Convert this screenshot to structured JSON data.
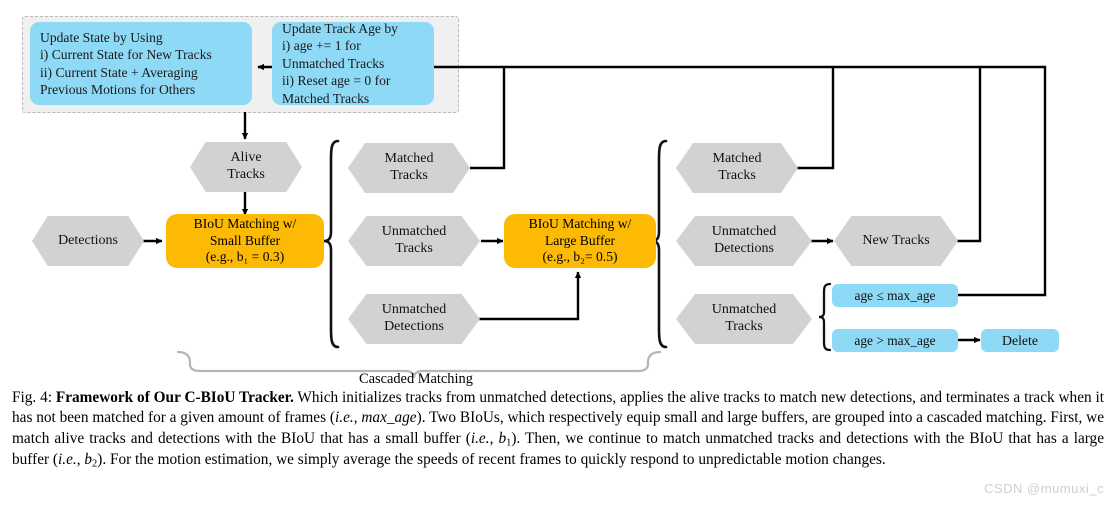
{
  "figure": {
    "update_state_box": {
      "lines": [
        "Update State by Using",
        "i) Current State for New Tracks",
        "ii) Current State + Averaging",
        "Previous Motions for Others"
      ]
    },
    "update_age_box": {
      "lines": [
        "Update Track Age  by",
        "i) age += 1 for",
        "Unmatched Tracks",
        "ii) Reset  age = 0 for",
        "Matched Tracks"
      ]
    },
    "nodes": {
      "alive_tracks": [
        "Alive",
        "Tracks"
      ],
      "detections": [
        "Detections"
      ],
      "biou_small": [
        "BIoU Matching w/",
        "Small Buffer",
        "(e.g., b₁ = 0.3)"
      ],
      "biou_large": [
        "BIoU Matching w/",
        "Large Buffer",
        "(e.g., b₂= 0.5)"
      ],
      "matched_tracks_mid": [
        "Matched",
        "Tracks"
      ],
      "unmatched_tracks_mid": [
        "Unmatched",
        "Tracks"
      ],
      "unmatched_detections_mid": [
        "Unmatched",
        "Detections"
      ],
      "matched_tracks_right": [
        "Matched",
        "Tracks"
      ],
      "unmatched_detections_right": [
        "Unmatched",
        "Detections"
      ],
      "unmatched_tracks_right": [
        "Unmatched",
        "Tracks"
      ],
      "new_tracks": [
        "New Tracks"
      ],
      "age_le": "age ≤ max_age",
      "age_gt": "age > max_age",
      "delete": "Delete"
    },
    "brace_label": "Cascaded Matching"
  },
  "caption": {
    "figure_number": "Fig. 4:",
    "title": "Framework of Our C-BIoU Tracker.",
    "body_1": " Which initializes tracks from unmatched detections, applies the alive tracks to match new detections, and terminates a track when it has not been matched for a given amount of frames (",
    "ie_1": "i.e.",
    "sep_1": ", ",
    "math_1": "max_age",
    "body_2": "). Two BIoUs, which respectively equip small and large buffers, are grouped into a cascaded matching. First, we match alive tracks and detections with the BIoU that has a small buffer (",
    "ie_2": "i.e.",
    "sep_2": ", ",
    "math_2_base": "b",
    "math_2_sub": "1",
    "body_3": "). Then, we continue to match unmatched tracks and detections with the BIoU that has a large buffer (",
    "ie_3": "i.e.",
    "sep_3": ", ",
    "math_3_base": "b",
    "math_3_sub": "2",
    "body_4": "). For the motion estimation, we simply average the speeds of recent frames to quickly respond to unpredictable motion changes."
  },
  "watermark": "CSDN @mumuxi_c",
  "colors": {
    "blue": "#8ed9f5",
    "orange": "#fcba04",
    "gray": "#d2d2d2",
    "dashed_border": "#b8b8b8",
    "dashed_fill": "#f0f0f0",
    "arrow": "#000000",
    "brace_gray": "#b5b5b5",
    "watermark": "#cfcfcf"
  }
}
